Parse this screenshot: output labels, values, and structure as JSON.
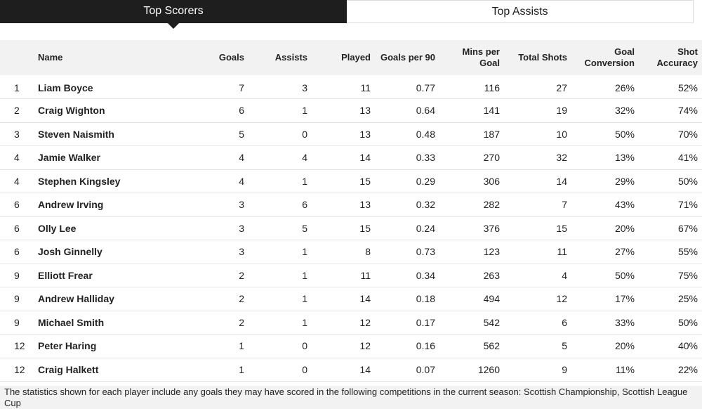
{
  "tabs": [
    {
      "label": "Top Scorers",
      "active": true
    },
    {
      "label": "Top Assists",
      "active": false
    }
  ],
  "table": {
    "headers": {
      "rank": "",
      "name": "Name",
      "goals": "Goals",
      "assists": "Assists",
      "played": "Played",
      "goals_per_90": "Goals per 90",
      "mins_per_goal": "Mins per Goal",
      "total_shots": "Total Shots",
      "goal_conversion": "Goal Conversion",
      "shot_accuracy": "Shot Accuracy"
    },
    "rows": [
      {
        "rank": "1",
        "name": "Liam Boyce",
        "goals": "7",
        "assists": "3",
        "played": "11",
        "goals_per_90": "0.77",
        "mins_per_goal": "116",
        "total_shots": "27",
        "goal_conversion": "26%",
        "shot_accuracy": "52%"
      },
      {
        "rank": "2",
        "name": "Craig Wighton",
        "goals": "6",
        "assists": "1",
        "played": "13",
        "goals_per_90": "0.64",
        "mins_per_goal": "141",
        "total_shots": "19",
        "goal_conversion": "32%",
        "shot_accuracy": "74%"
      },
      {
        "rank": "3",
        "name": "Steven Naismith",
        "goals": "5",
        "assists": "0",
        "played": "13",
        "goals_per_90": "0.48",
        "mins_per_goal": "187",
        "total_shots": "10",
        "goal_conversion": "50%",
        "shot_accuracy": "70%"
      },
      {
        "rank": "4",
        "name": "Jamie Walker",
        "goals": "4",
        "assists": "4",
        "played": "14",
        "goals_per_90": "0.33",
        "mins_per_goal": "270",
        "total_shots": "32",
        "goal_conversion": "13%",
        "shot_accuracy": "41%"
      },
      {
        "rank": "4",
        "name": "Stephen Kingsley",
        "goals": "4",
        "assists": "1",
        "played": "15",
        "goals_per_90": "0.29",
        "mins_per_goal": "306",
        "total_shots": "14",
        "goal_conversion": "29%",
        "shot_accuracy": "50%"
      },
      {
        "rank": "6",
        "name": "Andrew Irving",
        "goals": "3",
        "assists": "6",
        "played": "13",
        "goals_per_90": "0.32",
        "mins_per_goal": "282",
        "total_shots": "7",
        "goal_conversion": "43%",
        "shot_accuracy": "71%"
      },
      {
        "rank": "6",
        "name": "Olly Lee",
        "goals": "3",
        "assists": "5",
        "played": "15",
        "goals_per_90": "0.24",
        "mins_per_goal": "376",
        "total_shots": "15",
        "goal_conversion": "20%",
        "shot_accuracy": "67%"
      },
      {
        "rank": "6",
        "name": "Josh Ginnelly",
        "goals": "3",
        "assists": "1",
        "played": "8",
        "goals_per_90": "0.73",
        "mins_per_goal": "123",
        "total_shots": "11",
        "goal_conversion": "27%",
        "shot_accuracy": "55%"
      },
      {
        "rank": "9",
        "name": "Elliott Frear",
        "goals": "2",
        "assists": "1",
        "played": "11",
        "goals_per_90": "0.34",
        "mins_per_goal": "263",
        "total_shots": "4",
        "goal_conversion": "50%",
        "shot_accuracy": "75%"
      },
      {
        "rank": "9",
        "name": "Andrew Halliday",
        "goals": "2",
        "assists": "1",
        "played": "14",
        "goals_per_90": "0.18",
        "mins_per_goal": "494",
        "total_shots": "12",
        "goal_conversion": "17%",
        "shot_accuracy": "25%"
      },
      {
        "rank": "9",
        "name": "Michael Smith",
        "goals": "2",
        "assists": "1",
        "played": "12",
        "goals_per_90": "0.17",
        "mins_per_goal": "542",
        "total_shots": "6",
        "goal_conversion": "33%",
        "shot_accuracy": "50%"
      },
      {
        "rank": "12",
        "name": "Peter Haring",
        "goals": "1",
        "assists": "0",
        "played": "12",
        "goals_per_90": "0.16",
        "mins_per_goal": "562",
        "total_shots": "5",
        "goal_conversion": "20%",
        "shot_accuracy": "40%"
      },
      {
        "rank": "12",
        "name": "Craig Halkett",
        "goals": "1",
        "assists": "0",
        "played": "14",
        "goals_per_90": "0.07",
        "mins_per_goal": "1260",
        "total_shots": "9",
        "goal_conversion": "11%",
        "shot_accuracy": "22%"
      }
    ]
  },
  "footnote": "The statistics shown for each player include any goals they may have scored in the following competitions in the current season: Scottish Championship, Scottish League Cup",
  "colors": {
    "active_tab_bg": "#1e1e1e",
    "header_bg": "#f2f2f2",
    "row_border": "#e4e4e4"
  }
}
